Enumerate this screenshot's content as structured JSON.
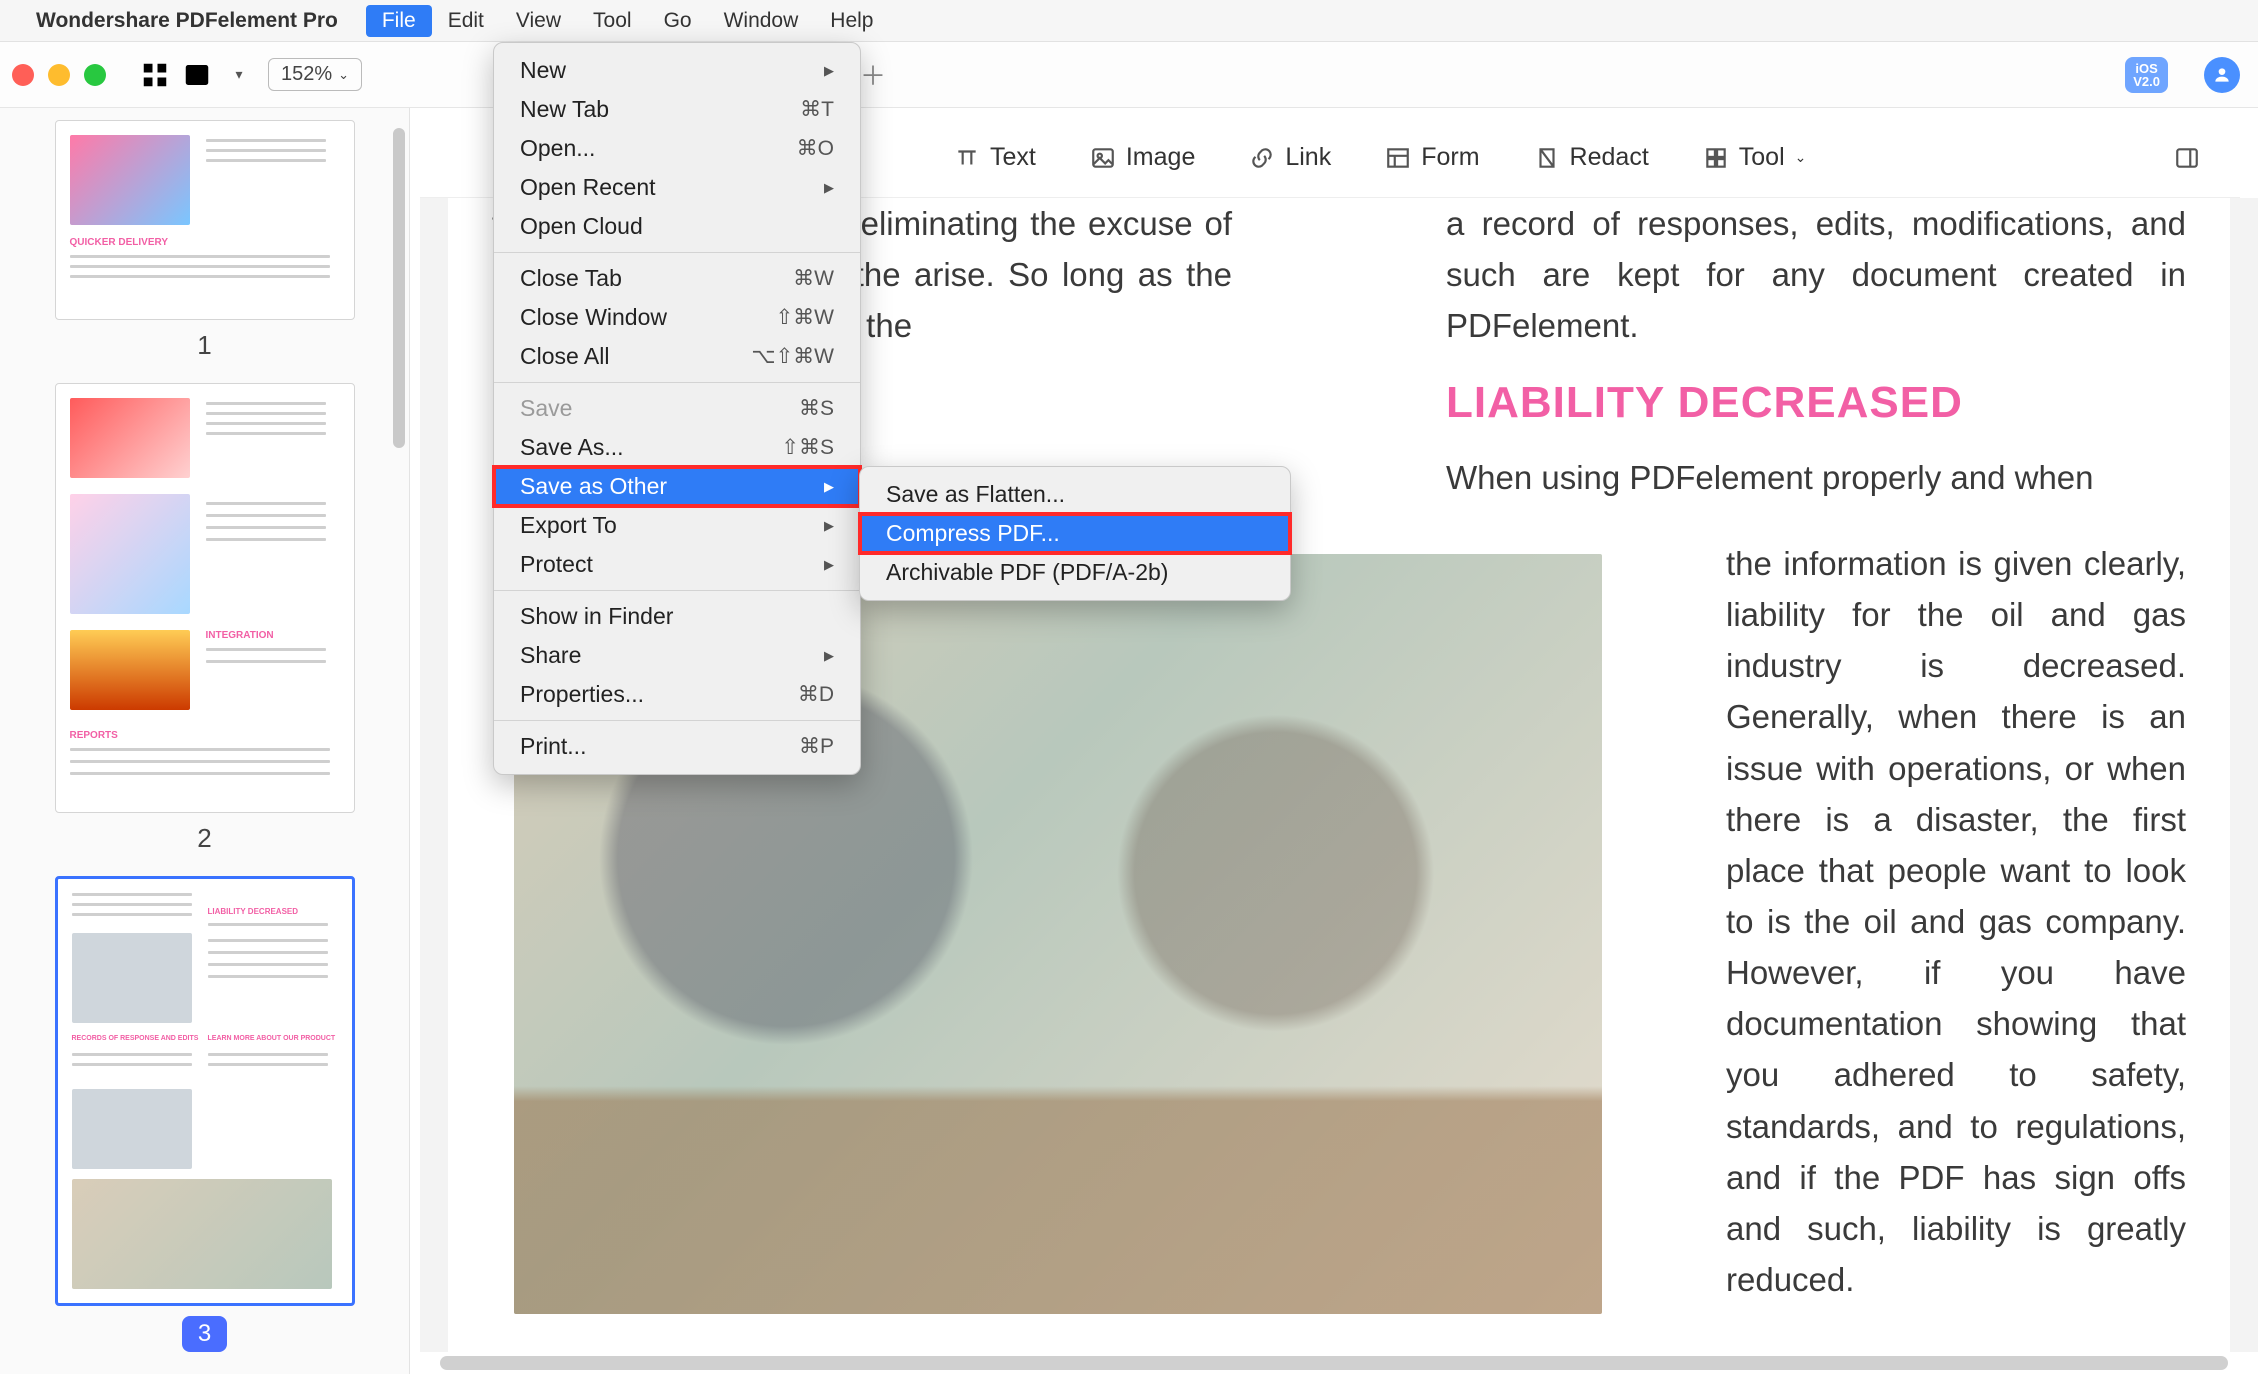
{
  "menubar": {
    "app_name": "Wondershare PDFelement Pro",
    "items": [
      "File",
      "Edit",
      "View",
      "Tool",
      "Go",
      "Window",
      "Help"
    ],
    "active_index": 0
  },
  "toolbar": {
    "zoom": "152%",
    "ios_badge": "iOS\nV2.0"
  },
  "actionbar": {
    "text": "Text",
    "image": "Image",
    "link": "Link",
    "form": "Form",
    "redact": "Redact",
    "tool": "Tool"
  },
  "file_menu": [
    {
      "label": "New",
      "arrow": true
    },
    {
      "label": "New Tab",
      "shortcut": "⌘T"
    },
    {
      "label": "Open...",
      "shortcut": "⌘O"
    },
    {
      "label": "Open Recent",
      "arrow": true
    },
    {
      "label": "Open Cloud"
    },
    {
      "sep": true
    },
    {
      "label": "Close Tab",
      "shortcut": "⌘W"
    },
    {
      "label": "Close Window",
      "shortcut": "⇧⌘W"
    },
    {
      "label": "Close All",
      "shortcut": "⌥⇧⌘W"
    },
    {
      "sep": true
    },
    {
      "label": "Save",
      "shortcut": "⌘S",
      "disabled": true
    },
    {
      "label": "Save As...",
      "shortcut": "⇧⌘S"
    },
    {
      "label": "Save as Other",
      "arrow": true,
      "highlight": true,
      "redbox": true
    },
    {
      "label": "Export To",
      "arrow": true
    },
    {
      "label": "Protect",
      "arrow": true
    },
    {
      "sep": true
    },
    {
      "label": "Show in Finder"
    },
    {
      "label": "Share",
      "arrow": true
    },
    {
      "label": "Properties...",
      "shortcut": "⌘D"
    },
    {
      "sep": true
    },
    {
      "label": "Print...",
      "shortcut": "⌘P"
    }
  ],
  "submenu": [
    {
      "label": "Save as Flatten..."
    },
    {
      "label": "Compress PDF...",
      "highlight": true,
      "redbox": true
    },
    {
      "label": "Archivable PDF (PDF/A-2b)"
    }
  ],
  "thumbnails": {
    "pages": [
      "1",
      "2",
      "3"
    ],
    "selected_index": 2
  },
  "document": {
    "left_para": "to access information at eliminating the excuse of ch anyone by phone in the arise. So long as the PDF excuse not to follow the",
    "right_top": "a record of responses, edits, modifications, and such are kept for any document created in PDFelement.",
    "heading": "LIABILITY DECREASED",
    "right_lead": "When using PDFelement properly and when",
    "right_body": "the information is given clearly, liability for the oil and gas industry is decreased. Generally, when there is an issue with operations, or when there is a disaster, the first place that people want to look to is the oil and gas company. However, if you have documentation showing that you adhered to safety, standards, and to regulations, and if the PDF has sign offs and such, liability is greatly reduced."
  }
}
